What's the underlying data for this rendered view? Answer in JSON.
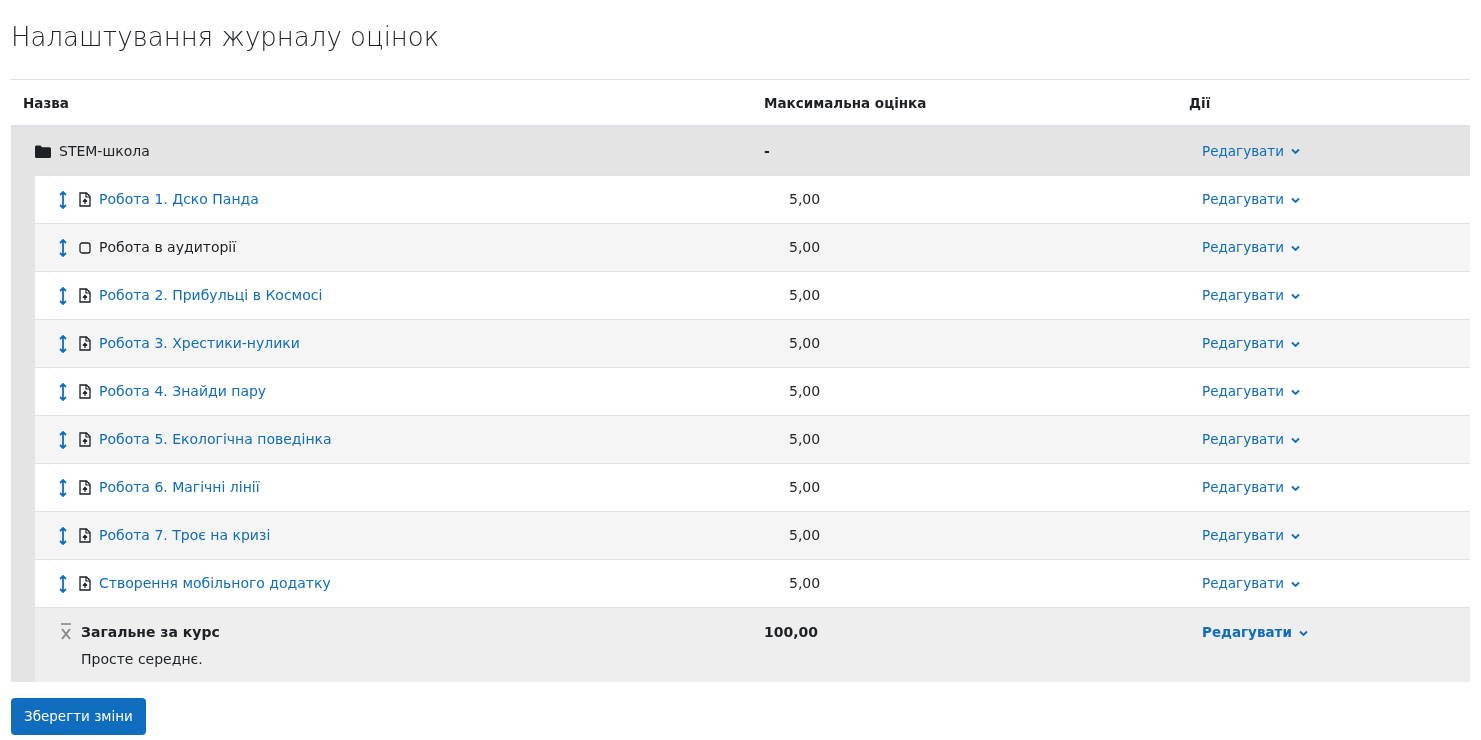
{
  "title": "Налаштування журналу оцінок",
  "columns": [
    "Назва",
    "Максимальна оцінка",
    "Дії"
  ],
  "category": {
    "name": "STEM-школа",
    "max_grade": "-",
    "action": "Редагувати"
  },
  "items": [
    {
      "kind": "assignment",
      "name": "Робота 1. Дско Панда",
      "max_grade": "5,00",
      "action": "Редагувати"
    },
    {
      "kind": "manual",
      "name": "Робота в аудиторії",
      "max_grade": "5,00",
      "action": "Редагувати"
    },
    {
      "kind": "assignment",
      "name": "Робота 2. Прибульці в Космосі",
      "max_grade": "5,00",
      "action": "Редагувати"
    },
    {
      "kind": "assignment",
      "name": "Робота 3. Хрестики-нулики",
      "max_grade": "5,00",
      "action": "Редагувати"
    },
    {
      "kind": "assignment",
      "name": "Робота 4. Знайди пару",
      "max_grade": "5,00",
      "action": "Редагувати"
    },
    {
      "kind": "assignment",
      "name": "Робота 5. Екологічна поведінка",
      "max_grade": "5,00",
      "action": "Редагувати"
    },
    {
      "kind": "assignment",
      "name": "Робота 6. Магічні лінії",
      "max_grade": "5,00",
      "action": "Редагувати"
    },
    {
      "kind": "assignment",
      "name": "Робота 7. Троє на кризі",
      "max_grade": "5,00",
      "action": "Редагувати"
    },
    {
      "kind": "assignment",
      "name": "Створення мобільного додатку",
      "max_grade": "5,00",
      "action": "Редагувати"
    }
  ],
  "total": {
    "name": "Загальне за курс",
    "description": "Просте середнє.",
    "max_grade": "100,00",
    "action": "Редагувати"
  },
  "save_button": "Зберегти зміни"
}
